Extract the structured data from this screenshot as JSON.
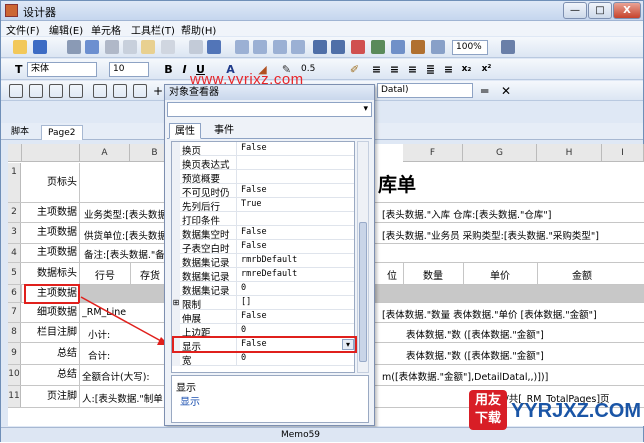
{
  "window": {
    "title": "设计器",
    "min_label": "—",
    "max_label": "□",
    "close_label": "X"
  },
  "menu": [
    "文件(F)",
    "编辑(E)",
    "单元格",
    "工具栏(T)",
    "帮助(H)"
  ],
  "toolbar": {
    "font_name": "宋体",
    "font_size": "10",
    "zoom": "100%",
    "line_width": "0.5",
    "bold": "B",
    "italic": "I",
    "underline": "U",
    "subscript": "x₂",
    "superscript": "x²",
    "datasource_combo": "Datal)"
  },
  "watermark": "www.yyrjxz.com",
  "tabs": [
    "脚本",
    "Page2"
  ],
  "columns": [
    "A",
    "B",
    "F",
    "G",
    "H",
    "I"
  ],
  "rows": [
    {
      "num": "1",
      "label": "页标头",
      "text": ""
    },
    {
      "num": "2",
      "label": "主项数据",
      "text": "业务类型:[表头数据.\"业务类型\"]",
      "right": "[表头数据.\"入库 仓库:[表头数据.\"仓库\"]"
    },
    {
      "num": "3",
      "label": "主项数据",
      "text": "供货单位:[表头数据.\"供货单位\"]",
      "right": "[表头数据.\"业务员 采购类型:[表头数据.\"采购类型\"]"
    },
    {
      "num": "4",
      "label": "主项数据",
      "text": "备注:[表头数据.\"备注\"]",
      "right": ""
    },
    {
      "num": "5",
      "label": "数据标头",
      "text": ""
    },
    {
      "num": "6",
      "label": "主项数据",
      "text": ""
    },
    {
      "num": "7",
      "label": "细项数据",
      "text": "_RM_Line",
      "right": "[表体数据.\"数量 表体数据.\"单价 [表体数据.\"金额\"]"
    },
    {
      "num": "8",
      "label": "栏目注脚",
      "text": "小计:",
      "right": "表体数据.\"数 ([表体数据.\"金额\"]"
    },
    {
      "num": "9",
      "label": "总结",
      "text": "合计:",
      "right": "表体数据.\"数 ([表体数据.\"金额\"]"
    },
    {
      "num": "10",
      "label": "总结",
      "text": "全额合计(大写):",
      "right": "m([表体数据.\"金额\"],DetailDatal,,)])]"
    },
    {
      "num": "11",
      "label": "页注脚",
      "text": "人:[表头数据.\"制单",
      "right": "页/共[_RM_TotalPages]页"
    }
  ],
  "big_title_partial": "库单",
  "header_cells": {
    "qty": "数量",
    "price": "单价",
    "amount": "金额",
    "seq": "行号",
    "stock": "存货",
    "unit": "位"
  },
  "inspector": {
    "title": "对象查看器",
    "tabs": [
      "属性",
      "事件"
    ],
    "props": [
      {
        "name": "换页",
        "value": "False"
      },
      {
        "name": "换页表达式",
        "value": ""
      },
      {
        "name": "预览概要",
        "value": ""
      },
      {
        "name": "不可见时仍",
        "value": "False"
      },
      {
        "name": "先列后行",
        "value": "True"
      },
      {
        "name": "打印条件",
        "value": ""
      },
      {
        "name": "数据集空时",
        "value": "False"
      },
      {
        "name": "子表空白时",
        "value": "False"
      },
      {
        "name": "数据集记录",
        "value": "rmrbDefault"
      },
      {
        "name": "数据集记录",
        "value": "rmreDefault"
      },
      {
        "name": "数据集记录",
        "value": "0"
      },
      {
        "name": "限制",
        "value": "[]"
      },
      {
        "name": "伸展",
        "value": "False"
      },
      {
        "name": "上边距",
        "value": "0"
      },
      {
        "name": "显示",
        "value": "False"
      },
      {
        "name": "宽",
        "value": "0"
      }
    ],
    "desc_title": "显示",
    "desc_text": "显示"
  },
  "status": {
    "memo": "Memo59"
  },
  "brand": {
    "cn_top": "用友",
    "cn_bottom": "下载",
    "latin": "YYRJXZ.COM"
  },
  "colors": {
    "accent_red": "#e0201c",
    "watermark_red": "#e8262a",
    "logo_red": "#d81e26",
    "logo_blue": "#1a55a6"
  }
}
